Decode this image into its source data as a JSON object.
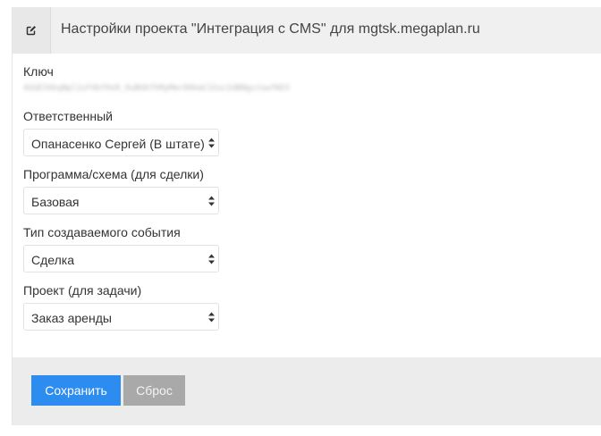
{
  "header": {
    "icon": "edit-icon",
    "title": "Настройки проекта \"Интеграция с CMS\" для mgtsk.megaplan.ru"
  },
  "form": {
    "key": {
      "label": "Ключ",
      "value": "4GGE34kqNpl2zF4bfHxR_0uBGKfhMyMmr00kmC32ucSdBNgstowfNIV"
    },
    "responsible": {
      "label": "Ответственный",
      "selected": "Опанасенко Сергей (В штате)"
    },
    "program": {
      "label": "Программа/схема (для сделки)",
      "selected": "Базовая"
    },
    "event_type": {
      "label": "Тип создаваемого события",
      "selected": "Сделка"
    },
    "project": {
      "label": "Проект (для задачи)",
      "selected": "Заказ аренды"
    }
  },
  "footer": {
    "save_label": "Сохранить",
    "reset_label": "Сброс"
  },
  "colors": {
    "accent": "#2d8cf0",
    "secondary_button": "#a9a9a9",
    "header_bg": "#f0f0f0",
    "footer_bg": "#ececec"
  }
}
